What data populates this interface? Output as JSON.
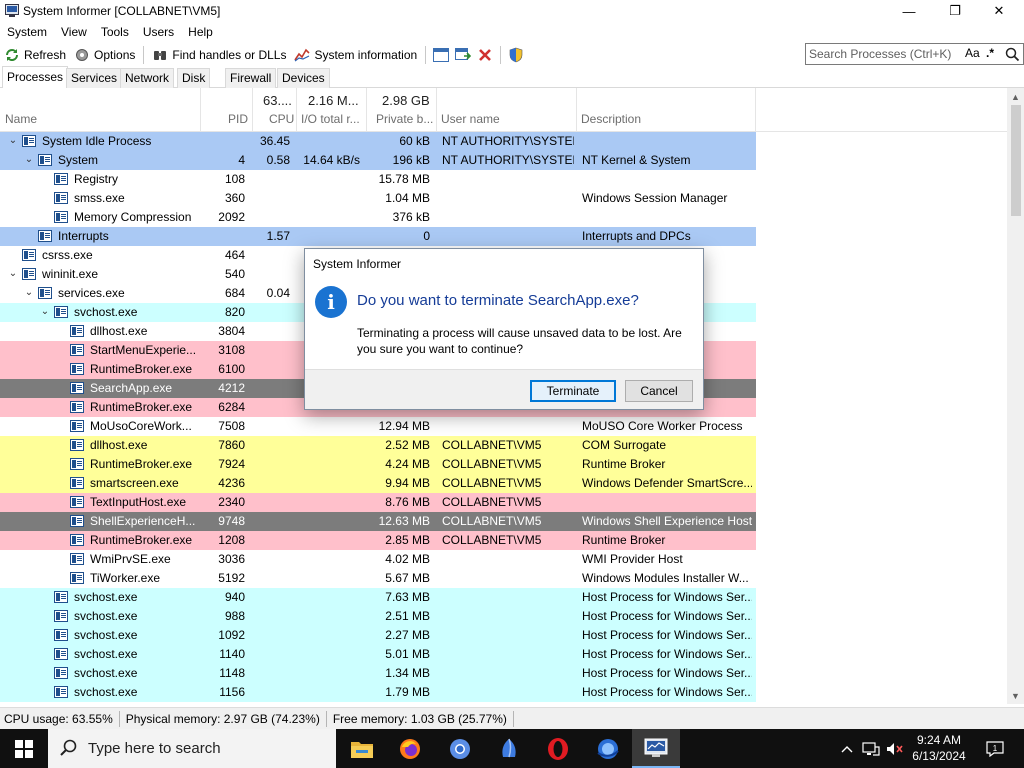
{
  "window": {
    "title": "System Informer [COLLABNET\\VM5]",
    "minimize": "—",
    "maximize": "❐",
    "close": "✕"
  },
  "menu": [
    "System",
    "View",
    "Tools",
    "Users",
    "Help"
  ],
  "toolbar": {
    "refresh": "Refresh",
    "options": "Options",
    "find_handles": "Find handles or DLLs",
    "system_information": "System information"
  },
  "search": {
    "placeholder": "Search Processes (Ctrl+K)",
    "match_case": "Aa",
    "regex": ".*"
  },
  "tabs": [
    "Processes",
    "Services",
    "Network",
    "Disk",
    "Firewall",
    "Devices"
  ],
  "columns": {
    "name": "Name",
    "pid": "PID",
    "cpu_total": "63....",
    "cpu": "CPU",
    "io_total": "2.16 M...",
    "io": "I/O total r...",
    "private_total": "2.98 GB",
    "private": "Private b...",
    "user": "User name",
    "description": "Description"
  },
  "row_colors": {
    "system": "#aac9f4",
    "service": "#ccffff",
    "own": "#ffff99",
    "immersive": "#ffc0cb",
    "suspended": "#7c7c7c",
    "selected": "#7c7c7c",
    "none": "#ffffff"
  },
  "processes": [
    {
      "indent": 0,
      "toggle": "expanded",
      "name": "System Idle Process",
      "pid": "",
      "cpu": "36.45",
      "io": "",
      "private": "60 kB",
      "user": "NT AUTHORITY\\SYSTEM",
      "desc": "",
      "color": "system"
    },
    {
      "indent": 1,
      "toggle": "expanded",
      "name": "System",
      "pid": "4",
      "cpu": "0.58",
      "io": "14.64 kB/s",
      "private": "196 kB",
      "user": "NT AUTHORITY\\SYSTEM",
      "desc": "NT Kernel & System",
      "color": "system"
    },
    {
      "indent": 2,
      "toggle": "",
      "name": "Registry",
      "pid": "108",
      "cpu": "",
      "io": "",
      "private": "15.78 MB",
      "user": "",
      "desc": "",
      "color": "none"
    },
    {
      "indent": 2,
      "toggle": "",
      "name": "smss.exe",
      "pid": "360",
      "cpu": "",
      "io": "",
      "private": "1.04 MB",
      "user": "",
      "desc": "Windows Session Manager",
      "color": "none"
    },
    {
      "indent": 2,
      "toggle": "",
      "name": "Memory Compression",
      "pid": "2092",
      "cpu": "",
      "io": "",
      "private": "376 kB",
      "user": "",
      "desc": "",
      "color": "none"
    },
    {
      "indent": 1,
      "toggle": "",
      "name": "Interrupts",
      "pid": "",
      "cpu": "1.57",
      "io": "",
      "private": "0",
      "user": "",
      "desc": "Interrupts and DPCs",
      "color": "system"
    },
    {
      "indent": 0,
      "toggle": "",
      "name": "csrss.exe",
      "pid": "464",
      "cpu": "",
      "io": "",
      "private": "",
      "user": "",
      "desc": "rocess",
      "color": "none"
    },
    {
      "indent": 0,
      "toggle": "expanded",
      "name": "wininit.exe",
      "pid": "540",
      "cpu": "",
      "io": "",
      "private": "",
      "user": "",
      "desc": "lication",
      "color": "none"
    },
    {
      "indent": 1,
      "toggle": "expanded",
      "name": "services.exe",
      "pid": "684",
      "cpu": "0.04",
      "io": "",
      "private": "",
      "user": "",
      "desc": "App",
      "color": "none"
    },
    {
      "indent": 2,
      "toggle": "expanded",
      "name": "svchost.exe",
      "pid": "820",
      "cpu": "",
      "io": "",
      "private": "",
      "user": "",
      "desc": "ows Ser...",
      "color": "service"
    },
    {
      "indent": 3,
      "toggle": "",
      "name": "dllhost.exe",
      "pid": "3804",
      "cpu": "",
      "io": "",
      "private": "",
      "user": "",
      "desc": "",
      "color": "none"
    },
    {
      "indent": 3,
      "toggle": "",
      "name": "StartMenuExperie...",
      "pid": "3108",
      "cpu": "",
      "io": "",
      "private": "",
      "user": "",
      "desc": "",
      "color": "immersive"
    },
    {
      "indent": 3,
      "toggle": "",
      "name": "RuntimeBroker.exe",
      "pid": "6100",
      "cpu": "",
      "io": "",
      "private": "",
      "user": "",
      "desc": "",
      "color": "immersive"
    },
    {
      "indent": 3,
      "toggle": "",
      "name": "SearchApp.exe",
      "pid": "4212",
      "cpu": "",
      "io": "",
      "private": "",
      "user": "",
      "desc": "",
      "color": "selected"
    },
    {
      "indent": 3,
      "toggle": "",
      "name": "RuntimeBroker.exe",
      "pid": "6284",
      "cpu": "",
      "io": "",
      "private": "",
      "user": "",
      "desc": "",
      "color": "immersive"
    },
    {
      "indent": 3,
      "toggle": "",
      "name": "MoUsoCoreWork...",
      "pid": "7508",
      "cpu": "",
      "io": "",
      "private": "12.94 MB",
      "user": "",
      "desc": "MoUSO Core Worker Process",
      "color": "none"
    },
    {
      "indent": 3,
      "toggle": "",
      "name": "dllhost.exe",
      "pid": "7860",
      "cpu": "",
      "io": "",
      "private": "2.52 MB",
      "user": "COLLABNET\\VM5",
      "desc": "COM Surrogate",
      "color": "own"
    },
    {
      "indent": 3,
      "toggle": "",
      "name": "RuntimeBroker.exe",
      "pid": "7924",
      "cpu": "",
      "io": "",
      "private": "4.24 MB",
      "user": "COLLABNET\\VM5",
      "desc": "Runtime Broker",
      "color": "own"
    },
    {
      "indent": 3,
      "toggle": "",
      "name": "smartscreen.exe",
      "pid": "4236",
      "cpu": "",
      "io": "",
      "private": "9.94 MB",
      "user": "COLLABNET\\VM5",
      "desc": "Windows Defender SmartScre...",
      "color": "own"
    },
    {
      "indent": 3,
      "toggle": "",
      "name": "TextInputHost.exe",
      "pid": "2340",
      "cpu": "",
      "io": "",
      "private": "8.76 MB",
      "user": "COLLABNET\\VM5",
      "desc": "",
      "color": "immersive"
    },
    {
      "indent": 3,
      "toggle": "",
      "name": "ShellExperienceH...",
      "pid": "9748",
      "cpu": "",
      "io": "",
      "private": "12.63 MB",
      "user": "COLLABNET\\VM5",
      "desc": "Windows Shell Experience Host",
      "color": "suspended"
    },
    {
      "indent": 3,
      "toggle": "",
      "name": "RuntimeBroker.exe",
      "pid": "1208",
      "cpu": "",
      "io": "",
      "private": "2.85 MB",
      "user": "COLLABNET\\VM5",
      "desc": "Runtime Broker",
      "color": "immersive"
    },
    {
      "indent": 3,
      "toggle": "",
      "name": "WmiPrvSE.exe",
      "pid": "3036",
      "cpu": "",
      "io": "",
      "private": "4.02 MB",
      "user": "",
      "desc": "WMI Provider Host",
      "color": "none"
    },
    {
      "indent": 3,
      "toggle": "",
      "name": "TiWorker.exe",
      "pid": "5192",
      "cpu": "",
      "io": "",
      "private": "5.67 MB",
      "user": "",
      "desc": "Windows Modules Installer W...",
      "color": "none"
    },
    {
      "indent": 2,
      "toggle": "",
      "name": "svchost.exe",
      "pid": "940",
      "cpu": "",
      "io": "",
      "private": "7.63 MB",
      "user": "",
      "desc": "Host Process for Windows Ser...",
      "color": "service"
    },
    {
      "indent": 2,
      "toggle": "",
      "name": "svchost.exe",
      "pid": "988",
      "cpu": "",
      "io": "",
      "private": "2.51 MB",
      "user": "",
      "desc": "Host Process for Windows Ser...",
      "color": "service"
    },
    {
      "indent": 2,
      "toggle": "",
      "name": "svchost.exe",
      "pid": "1092",
      "cpu": "",
      "io": "",
      "private": "2.27 MB",
      "user": "",
      "desc": "Host Process for Windows Ser...",
      "color": "service"
    },
    {
      "indent": 2,
      "toggle": "",
      "name": "svchost.exe",
      "pid": "1140",
      "cpu": "",
      "io": "",
      "private": "5.01 MB",
      "user": "",
      "desc": "Host Process for Windows Ser...",
      "color": "service"
    },
    {
      "indent": 2,
      "toggle": "",
      "name": "svchost.exe",
      "pid": "1148",
      "cpu": "",
      "io": "",
      "private": "1.34 MB",
      "user": "",
      "desc": "Host Process for Windows Ser...",
      "color": "service"
    },
    {
      "indent": 2,
      "toggle": "",
      "name": "svchost.exe",
      "pid": "1156",
      "cpu": "",
      "io": "",
      "private": "1.79 MB",
      "user": "",
      "desc": "Host Process for Windows Ser...",
      "color": "service"
    }
  ],
  "status": {
    "cpu": "CPU usage: 63.55%",
    "physical": "Physical memory: 2.97 GB (74.23%)",
    "free": "Free memory: 1.03 GB (25.77%)"
  },
  "dialog": {
    "title": "System Informer",
    "heading": "Do you want to terminate SearchApp.exe?",
    "body": "Terminating a process will cause unsaved data to be lost. Are you sure you want to continue?",
    "info_glyph": "i",
    "terminate": "Terminate",
    "cancel": "Cancel"
  },
  "taskbar": {
    "search_placeholder": "Type here to search",
    "time": "9:24 AM",
    "date": "6/13/2024",
    "notification_count": "1",
    "apps": [
      "file-explorer",
      "firefox",
      "chromium",
      "app-blue",
      "opera",
      "app-globe",
      "system-informer"
    ]
  },
  "colors": {
    "accent": "#0078d7",
    "dialog_heading": "#153c97",
    "taskbar": "#101010"
  }
}
